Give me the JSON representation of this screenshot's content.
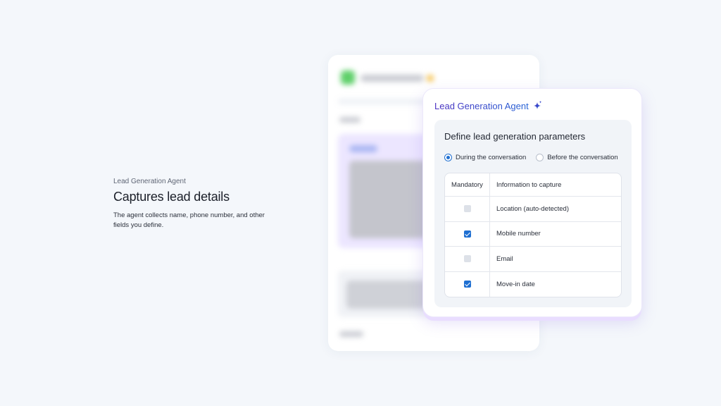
{
  "intro": {
    "eyebrow": "Lead Generation Agent",
    "headline": "Captures lead details",
    "description": "The agent collects name, phone number, and other fields you define."
  },
  "card": {
    "title": "Lead Generation Agent",
    "title_icon": "sparkle-icon",
    "panel_title": "Define lead generation parameters",
    "radios": [
      {
        "label": "During the conversation",
        "selected": true
      },
      {
        "label": "Before the conversation",
        "selected": false
      }
    ],
    "table": {
      "headers": [
        "Mandatory",
        "Information to capture"
      ],
      "rows": [
        {
          "label": "Location (auto-detected)",
          "checked": false
        },
        {
          "label": "Mobile number",
          "checked": true
        },
        {
          "label": "Email",
          "checked": false
        },
        {
          "label": "Move-in date",
          "checked": true
        }
      ]
    }
  },
  "colors": {
    "accent": "#1f6fd1",
    "title_gradient_start": "#4b2fc0",
    "title_gradient_end": "#2463d6",
    "background": "#f4f7fb"
  }
}
